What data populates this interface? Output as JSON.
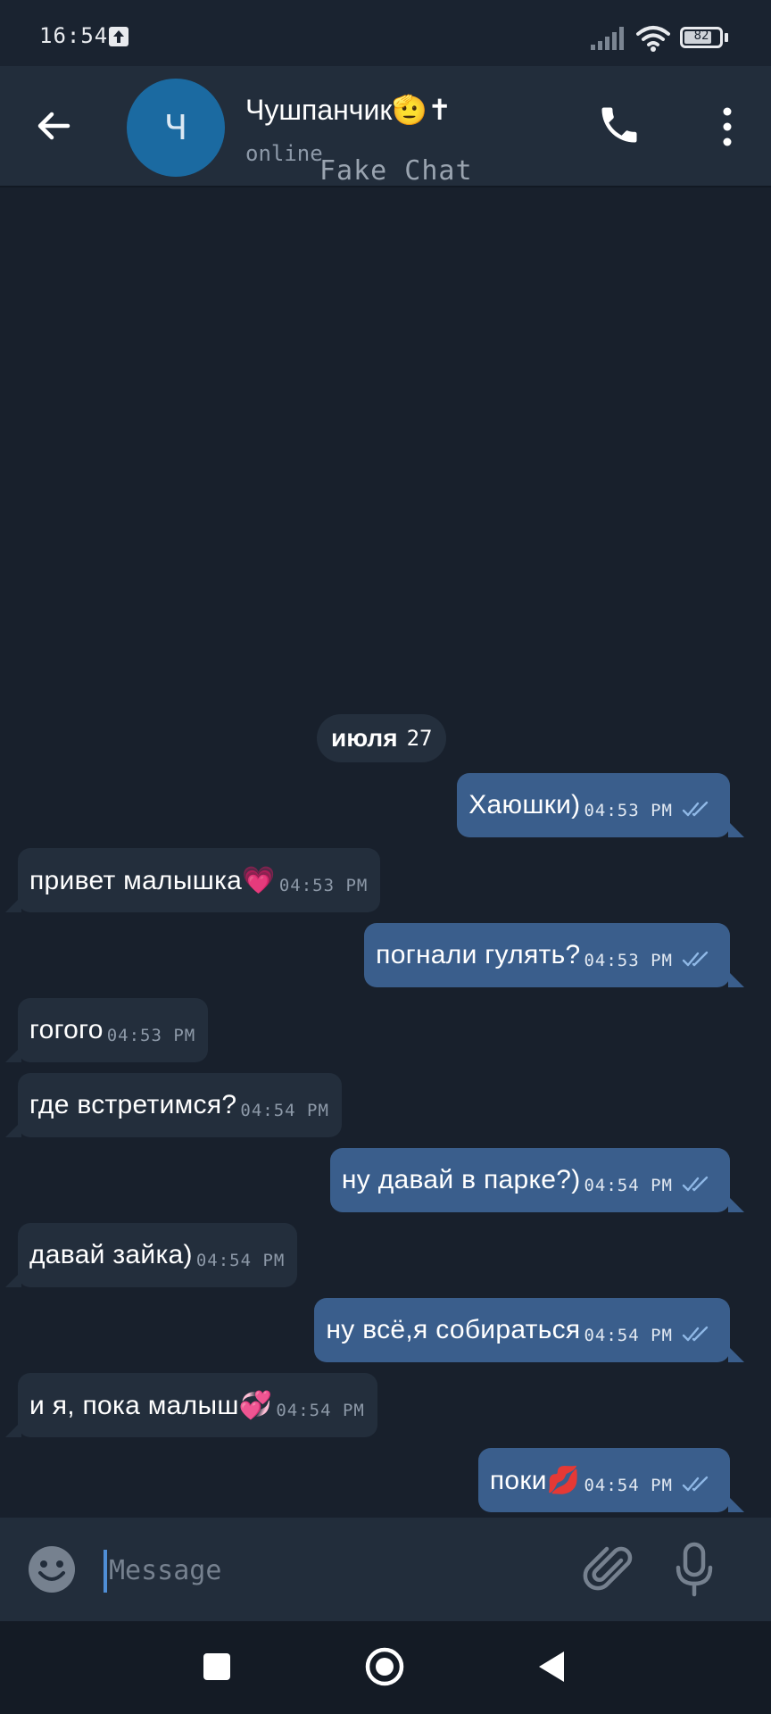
{
  "status_bar": {
    "time": "16:54",
    "battery": "82",
    "battery_level": 0.82,
    "icons": [
      "upload-icon",
      "signal-icon",
      "wifi-icon",
      "battery-icon"
    ]
  },
  "header": {
    "avatar_letter": "Ч",
    "avatar_color": "#1b6aa1",
    "contact_name": "Чушпанчик🫡✝",
    "status": "online",
    "watermark": "Fake Chat",
    "icons": [
      "back-arrow-icon",
      "phone-icon",
      "more-vert-icon"
    ]
  },
  "date_chip": {
    "word": "июля",
    "number": "27"
  },
  "messages": [
    {
      "dir": "out",
      "text": "Хаюшки)",
      "time": "04:53 PM",
      "read": true
    },
    {
      "dir": "in",
      "text": "привет малышка💗",
      "time": "04:53 PM"
    },
    {
      "dir": "out",
      "text": "погнали гулять?",
      "time": "04:53 PM",
      "read": true
    },
    {
      "dir": "in",
      "text": "гогого",
      "time": "04:53 PM"
    },
    {
      "dir": "in",
      "text": "где встретимся?",
      "time": "04:54 PM"
    },
    {
      "dir": "out",
      "text": "ну давай в парке?)",
      "time": "04:54 PM",
      "read": true
    },
    {
      "dir": "in",
      "text": "давай зайка)",
      "time": "04:54 PM"
    },
    {
      "dir": "out",
      "text": "ну всё,я собираться",
      "time": "04:54 PM",
      "read": true
    },
    {
      "dir": "in",
      "text": "и я, пока малыш💞",
      "time": "04:54 PM"
    },
    {
      "dir": "out",
      "text": "поки💋",
      "time": "04:54 PM",
      "read": true
    }
  ],
  "input": {
    "placeholder": "Message",
    "icons": [
      "emoji-icon",
      "attach-icon",
      "mic-icon"
    ]
  },
  "nav_bar": {
    "icons": [
      "recents-square-icon",
      "home-circle-icon",
      "back-triangle-icon"
    ]
  },
  "colors": {
    "background": "#18202c",
    "header": "#222d3b",
    "incoming_bubble": "#232e3c",
    "outgoing_bubble": "#3a5e8c",
    "read_ticks": "#8fb8e6"
  }
}
